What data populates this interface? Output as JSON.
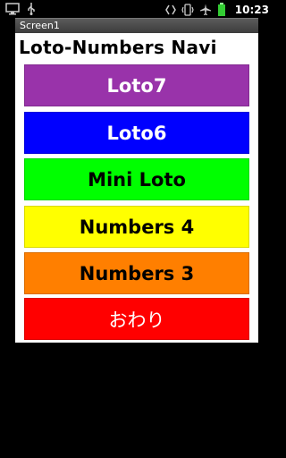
{
  "status_bar": {
    "time": "10:23",
    "icons": [
      "screen-icon",
      "usb-icon",
      "code-icon",
      "vibrate-icon",
      "airplane-icon",
      "battery-icon"
    ]
  },
  "window": {
    "title": "Screen1"
  },
  "app": {
    "title": "Loto-Numbers Navi",
    "buttons": [
      {
        "label": "Loto7",
        "color": "#9933aa"
      },
      {
        "label": "Loto6",
        "color": "#0000ff"
      },
      {
        "label": "Mini Loto",
        "color": "#00ff00"
      },
      {
        "label": "Numbers 4",
        "color": "#ffff00"
      },
      {
        "label": "Numbers 3",
        "color": "#ff7f00"
      },
      {
        "label": "おわり",
        "color": "#ff0000"
      }
    ]
  }
}
